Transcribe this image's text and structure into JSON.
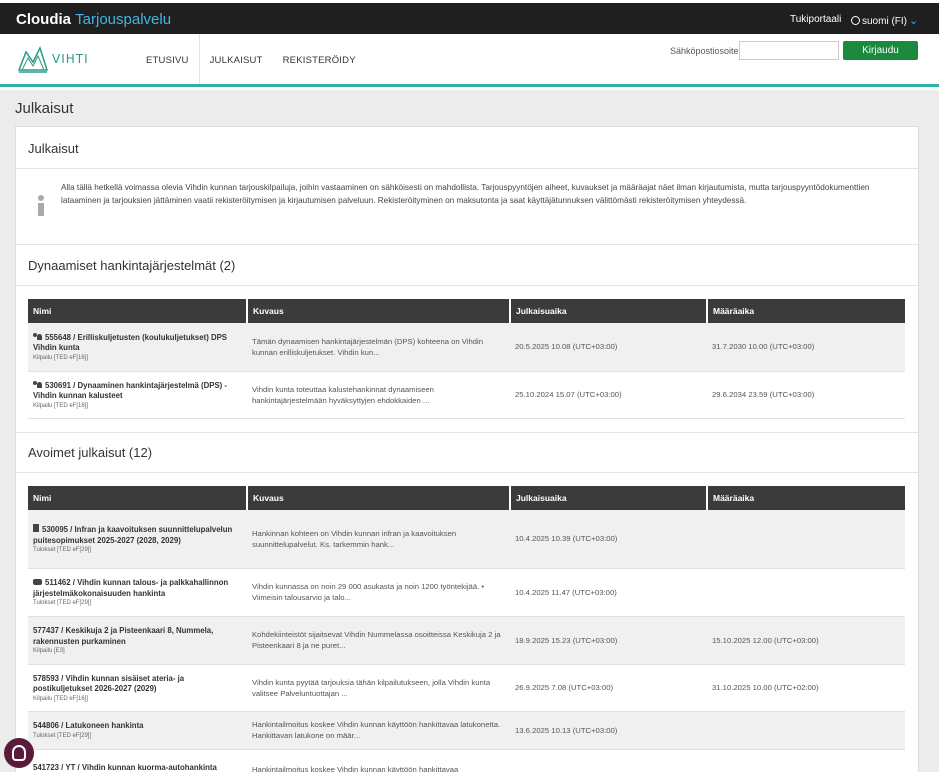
{
  "topbar": {
    "brand": "Cloudia",
    "brand_accent": "Tarjouspalvelu",
    "support_link": "Tukiportaali",
    "language": "suomi (FI)"
  },
  "nav": {
    "logo_text": "VIHTI",
    "links": [
      "ETUSIVU",
      "JULKAISUT",
      "REKISTERÖIDY"
    ],
    "active_link": "JULKAISUT",
    "login_label": "Sähköpostiosoite:",
    "login_placeholder": "",
    "login_button": "Kirjaudu"
  },
  "page": {
    "title": "Julkaisut",
    "card_title": "Julkaisut",
    "info_text": "Alla tällä hetkellä voimassa olevia Vihdin kunnan tarjouskilpailuja, joihin vastaaminen on sähköisesti on mahdollista. Tarjouspyyntöjen aiheet, kuvaukset ja määräajat näet ilman kirjautumista, mutta tarjouspyyntödokumenttien lataaminen ja tarjouksien jättäminen vaatii rekisteröitymisen ja kirjautumisen palveluun. Rekisteröityminen on maksutonta ja saat käyttäjätunnuksen välittömästi rekisteröitymisen yhteydessä."
  },
  "columns": {
    "name": "Nimi",
    "description": "Kuvaus",
    "published": "Julkaisuaika",
    "deadline": "Määräaika"
  },
  "dps": {
    "title": "Dynaamiset hankintajärjestelmät (2)",
    "rows": [
      {
        "icon": "users-icon",
        "name": "555648 / Erilliskuljetusten (koulukuljetukset) DPS Vihdin kunta",
        "type": "Kilpailu [TED eF[16]]",
        "description": "Tämän dynaamisen hankintajärjestelmän (DPS) kohteena on Vihdin kunnan erilliskuljetukset. Vihdin kun...",
        "published": "20.5.2025 10.08 (UTC+03:00)",
        "deadline": "31.7.2030 10.00 (UTC+03:00)"
      },
      {
        "icon": "users-icon",
        "name": "530691 / Dynaaminen hankintajärjestelmä (DPS) - Vihdin kunnan kalusteet",
        "type": "Kilpailu [TED eF[16]]",
        "description": "Vihdin kunta toteuttaa kalustehankinnat dynaamiseen hankintajärjestelmään hyväksyttyjen ehdokkaiden ...",
        "published": "25.10.2024 15.07 (UTC+03:00)",
        "deadline": "29.6.2034 23.59 (UTC+03:00)"
      }
    ]
  },
  "open": {
    "title": "Avoimet julkaisut (12)",
    "rows": [
      {
        "icon": "document-icon",
        "name": "530095 / Infran ja kaavoituksen suunnittelupalvelun puitesopimukset 2025-2027 (2028, 2029)",
        "type": "Tulokset [TED eF[29]]",
        "description": "Hankinnan kohteen on Vihdin kunnan infran ja kaavoituksen suunnittelupalvelut. Ks. tarkemmin hank...",
        "published": "10.4.2025 10.39 (UTC+03:00)",
        "deadline": ""
      },
      {
        "icon": "handshake-icon",
        "name": "511462 / Vihdin kunnan talous- ja palkkahallinnon järjestelmäkokonaisuuden hankinta",
        "type": "Tulokset [TED eF[29]]",
        "description": "Vihdin kunnassa on noin 29 000 asukasta ja noin 1200 työntekijää. • Viimeisin talousarvio ja talo...",
        "published": "10.4.2025 11.47 (UTC+03:00)",
        "deadline": ""
      },
      {
        "icon": "",
        "name": "577437 / Keskikuja 2 ja Pisteenkaari 8, Nummela, rakennusten purkaminen",
        "type": "Kilpailu [E3]",
        "description": "Kohdekiinteistöt sijaitsevat Vihdin Nummelassa osoitteissa Keskikuja 2 ja Pisteenkaari 8 ja ne puret...",
        "published": "18.9.2025 15.23 (UTC+03:00)",
        "deadline": "15.10.2025 12.00 (UTC+03:00)"
      },
      {
        "icon": "",
        "name": "578593 / Vihdin kunnan sisäiset ateria- ja postikuljetukset 2026-2027 (2029)",
        "type": "Kilpailu [TED eF[16]]",
        "description": "Vihdin kunta pyytää tarjouksia tähän kilpailutukseen, jolla Vihdin kunta valitsee Palveluntuottajan ...",
        "published": "26.9.2025 7.08 (UTC+03:00)",
        "deadline": "31.10.2025 10.00 (UTC+02:00)"
      },
      {
        "icon": "",
        "name": "544806 / Latukoneen hankinta",
        "type": "Tulokset [TED eF[29]]",
        "description": "Hankintailmoitus koskee Vihdin kunnan käyttöön hankittavaa latukonetta. Hankittavan latukone on määr...",
        "published": "13.6.2025 10.13 (UTC+03:00)",
        "deadline": ""
      },
      {
        "icon": "",
        "name": "541723 / YT / Vihdin kunnan kuorma-autohankinta",
        "type": "",
        "description": "Hankintailmoitus koskee Vihdin kunnan käyttöön hankittavaa",
        "published": "",
        "deadline": ""
      }
    ]
  }
}
